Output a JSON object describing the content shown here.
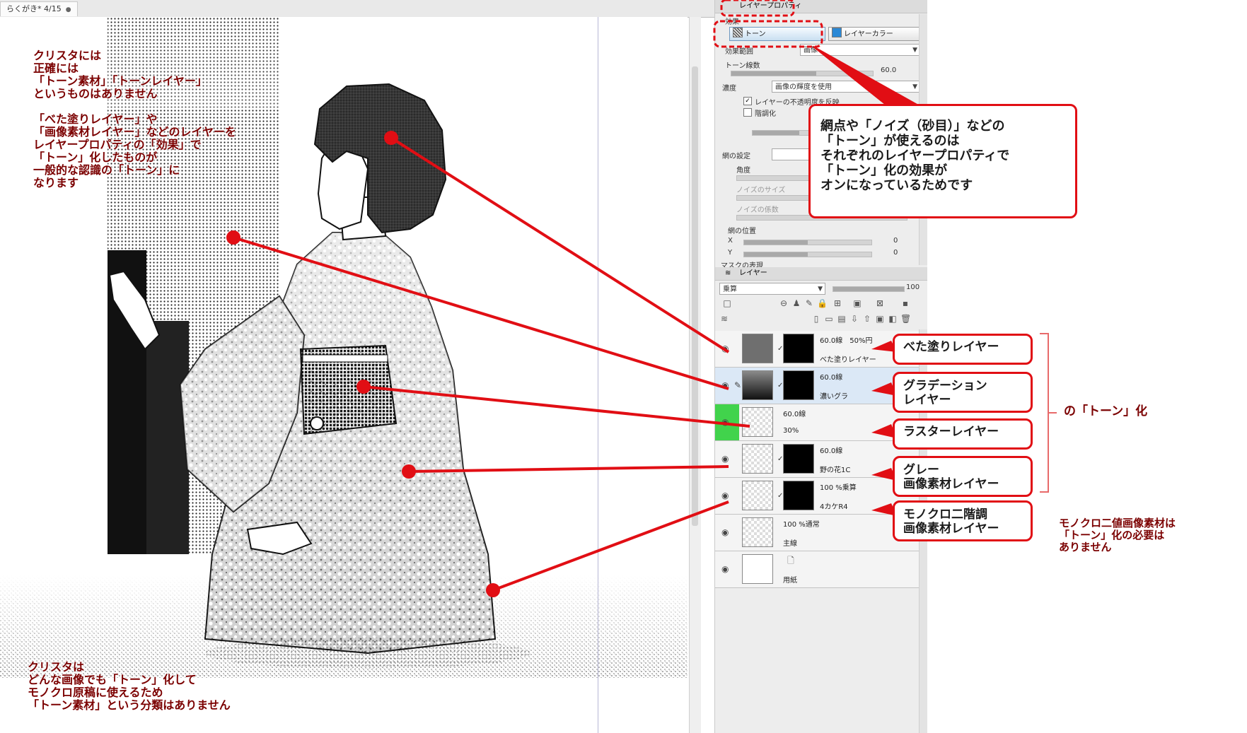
{
  "document_tab": {
    "title": "らくがき* 4/15"
  },
  "property_panel": {
    "title": "レイヤープロパティ",
    "effect_label": "効果",
    "tone_button": "トーン",
    "layer_color_button": "レイヤーカラー",
    "effect_range_label": "効果範囲",
    "effect_range_value": "画像",
    "screen_lines_label": "トーン線数",
    "screen_lines_value": "60.0",
    "density_label": "濃度",
    "density_value": "画像の輝度を使用",
    "reflect_opacity_label": "レイヤーの不透明度を反映",
    "posterize_label": "階調化",
    "screen_settings_label": "網の設定",
    "angle_label": "角度",
    "noise_size_label": "ノイズのサイズ",
    "noise_factor_label": "ノイズの係数",
    "position_label": "網の位置",
    "x_label": "X",
    "x_value": "0",
    "y_label": "Y",
    "y_value": "0",
    "mask_label": "マスクの表現"
  },
  "layer_panel": {
    "title": "レイヤー",
    "blend_mode": "乗算",
    "opacity_value": "100",
    "layers": [
      {
        "info": "60.0線　50%円",
        "name": "べた塗りレイヤー",
        "thumb": "gray",
        "visible": true
      },
      {
        "info": "60.0線",
        "name": "濃いグラ",
        "thumb": "gradient",
        "visible": true,
        "selected": true
      },
      {
        "info": "60.0線",
        "name": "30%",
        "thumb": "raster",
        "visible": true,
        "green_tag": true
      },
      {
        "info": "60.0線",
        "name": "野の花1C",
        "thumb": "image",
        "visible": true
      },
      {
        "info": "100 %乗算",
        "name": "4カケR4",
        "thumb": "image",
        "visible": true
      },
      {
        "info": "100 %通常",
        "name": "主線",
        "thumb": "blank",
        "visible": true
      },
      {
        "info": "",
        "name": "用紙",
        "thumb": "paper",
        "visible": true
      }
    ]
  },
  "annotations": {
    "top_left": "クリスタには\n正確には\n「トーン素材」「トーンレイヤー」\nというものはありません\n\n「べた塗りレイヤー」や\n「画像素材レイヤー」などのレイヤーを\nレイヤープロパティの「効果」で\n「トーン」化したものが\n一般的な認識の「トーン」に\nなります",
    "bottom_left": "クリスタは\nどんな画像でも「トーン」化して\nモノクロ原稿に使えるため\n「トーン素材」という分類はありません",
    "main_callout": "網点や「ノイズ（砂目）」などの\n「トーン」が使えるのは\nそれぞれのレイヤープロパティで\n「トーン」化の効果が\nオンになっているためです",
    "bracket_label": "の「トーン」化",
    "mono_note": "モノクロ二値画像素材は\n「トーン」化の必要は\nありません",
    "layer_callouts": [
      "べた塗りレイヤー",
      "グラデーション\nレイヤー",
      "ラスターレイヤー",
      "グレー\n画像素材レイヤー",
      "モノクロ二階調\n画像素材レイヤー"
    ]
  },
  "colors": {
    "annotation_red": "#e10e14",
    "annotation_text": "#7b0000",
    "green_tag": "#41d34c",
    "panel_bg": "#ededed"
  }
}
